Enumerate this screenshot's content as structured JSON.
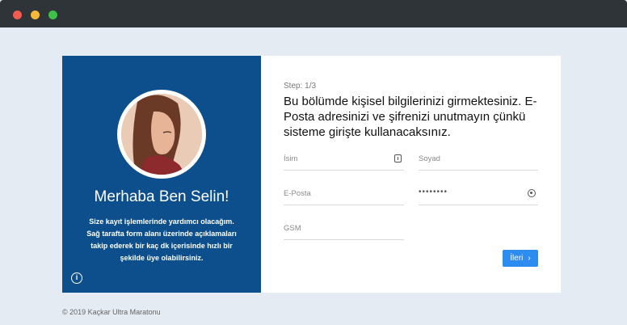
{
  "window": {
    "controls": [
      "close",
      "minimize",
      "maximize"
    ]
  },
  "left_panel": {
    "greeting": "Merhaba Ben Selin!",
    "description": "Size kayıt işlemlerinde yardımcı olacağım. Sağ tarafta form alanı üzerinde açıklamaları takip ederek bir kaç dk içerisinde hızlı bir şekilde üye olabilirsiniz.",
    "info_icon": "i"
  },
  "form": {
    "step": "Step: 1/3",
    "headline": "Bu bölümde kişisel bilgilerinizi girmektesiniz. E-Posta adresinizi ve şifrenizi unutmayın çünkü sisteme girişte kullanacaksınız.",
    "fields": {
      "name": "İsim",
      "surname": "Soyad",
      "email": "E-Posta",
      "password": "••••••••",
      "gsm": "GSM"
    },
    "next_button": "İleri",
    "next_icon": "›"
  },
  "footer": {
    "copyright": "© 2019 Kaçkar Ultra Maratonu"
  },
  "colors": {
    "panel": "#0c4f8c",
    "button": "#2d8cf0",
    "background": "#e4ebf2"
  }
}
